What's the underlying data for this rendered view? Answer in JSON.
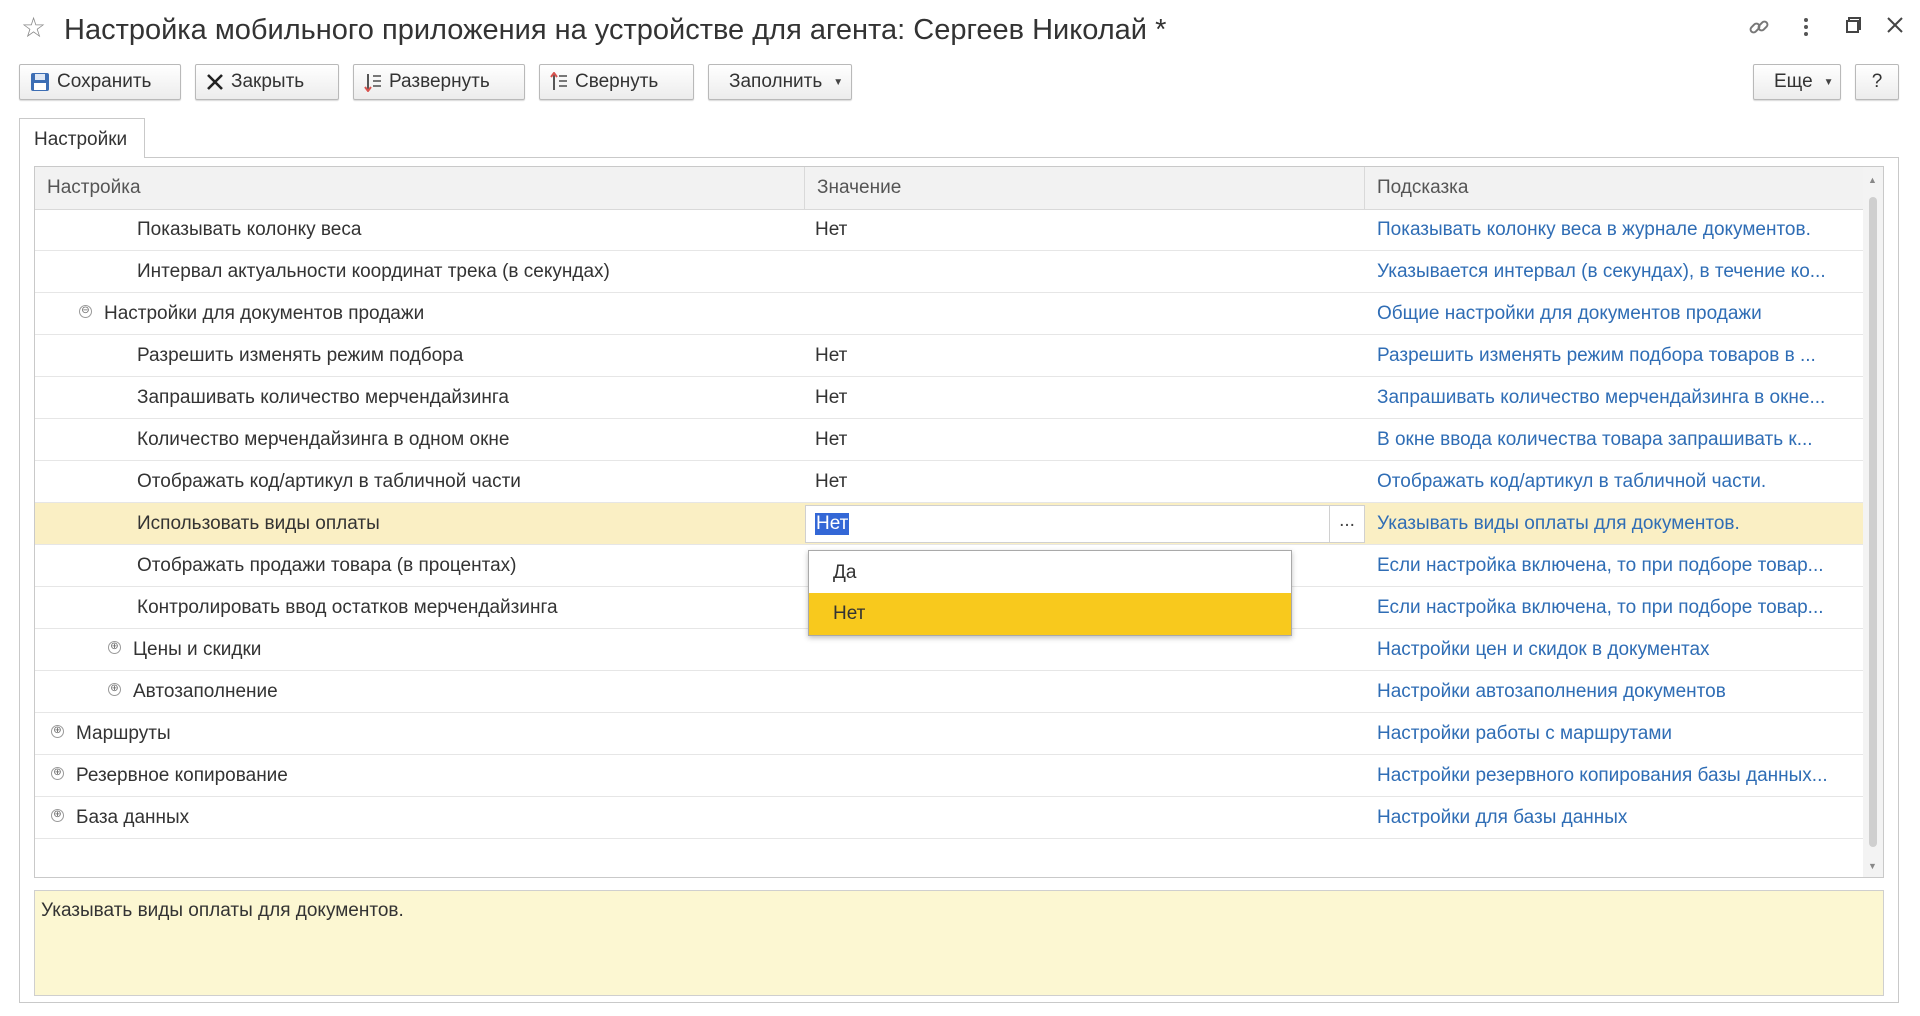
{
  "window": {
    "title": "Настройка мобильного приложения на устройстве для агента: Сергеев Николай *",
    "icons": [
      "star-icon",
      "link-icon",
      "more-vertical-icon",
      "maximize-icon",
      "close-icon"
    ]
  },
  "toolbar": {
    "save_label": "Сохранить",
    "close_label": "Закрыть",
    "expand_label": "Развернуть",
    "collapse_label": "Свернуть",
    "fill_label": "Заполнить",
    "more_label": "Еще",
    "help_label": "?"
  },
  "tabs": [
    {
      "label": "Настройки"
    }
  ],
  "table": {
    "columns": [
      "Настройка",
      "Значение",
      "Подсказка"
    ],
    "rows": [
      {
        "setting": "Показывать колонку веса",
        "value": "Нет",
        "hint": "Показывать колонку веса в журнале документов."
      },
      {
        "setting": "Интервал актуальности координат трека (в секундах)",
        "value": "",
        "hint": "Указывается интервал (в секундах), в течение ко..."
      },
      {
        "setting": "Настройки для документов продажи",
        "value": "",
        "hint": "Общие настройки для документов продажи",
        "expander": "⊖"
      },
      {
        "setting": "Разрешить изменять режим подбора",
        "value": "Нет",
        "hint": "Разрешить изменять режим подбора товаров в ..."
      },
      {
        "setting": "Запрашивать количество мерчендайзинга",
        "value": "Нет",
        "hint": "Запрашивать количество мерчендайзинга в окне..."
      },
      {
        "setting": "Количество мерчендайзинга в одном окне",
        "value": "Нет",
        "hint": "В окне ввода количества товара запрашивать к..."
      },
      {
        "setting": "Отображать код/артикул в табличной части",
        "value": "Нет",
        "hint": "Отображать код/артикул в табличной части."
      },
      {
        "setting": "Использовать виды оплаты",
        "value": "Нет",
        "hint": "Указывать виды оплаты для документов.",
        "selected": true
      },
      {
        "setting": "Отображать продажи товара (в процентах)",
        "value": "",
        "hint": "Если настройка включена, то при подборе товар..."
      },
      {
        "setting": "Контролировать ввод остатков мерчендайзинга",
        "value": "",
        "hint": "Если настройка включена, то при подборе товар..."
      },
      {
        "setting": "Цены и скидки",
        "value": "",
        "hint": "Настройки цен и скидок в документах",
        "expander": "⊕"
      },
      {
        "setting": "Автозаполнение",
        "value": "",
        "hint": "Настройки автозаполнения документов",
        "expander": "⊕"
      },
      {
        "setting": "Маршруты",
        "value": "",
        "hint": "Настройки работы с маршрутами",
        "expander": "⊕"
      },
      {
        "setting": "Резервное копирование",
        "value": "",
        "hint": "Настройки резервного копирования базы данных...",
        "expander": "⊕"
      },
      {
        "setting": "База данных",
        "value": "",
        "hint": "Настройки для базы данных",
        "expander": "⊕"
      }
    ]
  },
  "editor": {
    "value": "Нет",
    "choice_button": "..."
  },
  "dropdown": {
    "options": [
      "Да",
      "Нет"
    ],
    "selected": "Нет"
  },
  "hint_panel": {
    "text": "Указывать виды оплаты для документов."
  },
  "colors": {
    "accent_link": "#2f6db5",
    "selected_row": "#faefc4",
    "dropdown_highlight": "#f8c91d",
    "hint_background": "#fcf7d2"
  }
}
